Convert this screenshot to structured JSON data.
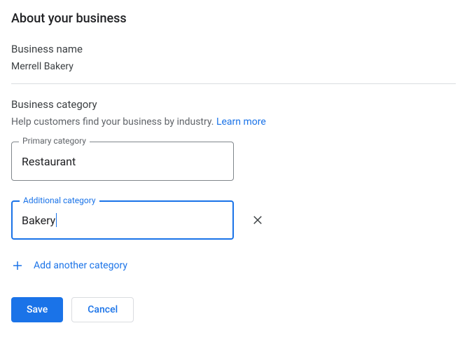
{
  "page": {
    "title": "About your business"
  },
  "businessName": {
    "label": "Business name",
    "value": "Merrell Bakery"
  },
  "businessCategory": {
    "label": "Business category",
    "helpText": "Help customers find your business by industry. ",
    "learnMore": "Learn more"
  },
  "primaryCategory": {
    "label": "Primary category",
    "value": "Restaurant"
  },
  "additionalCategory": {
    "label": "Additional category",
    "value": "Bakery"
  },
  "addAnother": {
    "label": "Add another category"
  },
  "buttons": {
    "save": "Save",
    "cancel": "Cancel"
  }
}
